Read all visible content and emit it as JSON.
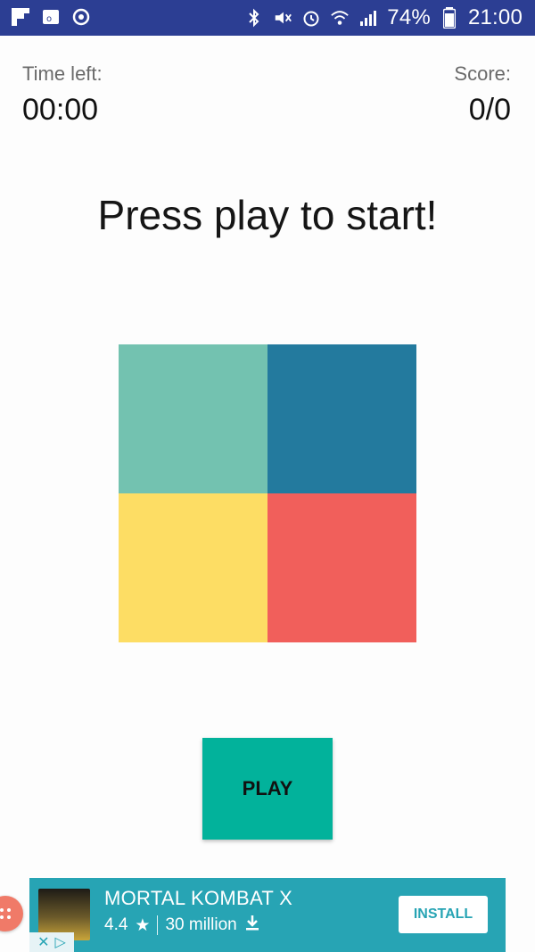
{
  "status_bar": {
    "battery": "74%",
    "time": "21:00",
    "icons": [
      "flipboard-icon",
      "outlook-icon",
      "sync-icon",
      "bluetooth-icon",
      "mute-icon",
      "alarm-icon",
      "wifi-icon",
      "signal-icon",
      "battery-icon"
    ]
  },
  "game": {
    "time_label": "Time left:",
    "time_value": "00:00",
    "score_label": "Score:",
    "score_value": "0/0",
    "prompt": "Press play to start!",
    "tiles": [
      "#73c2b0",
      "#237a9e",
      "#fddd64",
      "#f15f5b"
    ],
    "play_label": "PLAY"
  },
  "ad": {
    "title": "MORTAL KOMBAT X",
    "rating": "4.4",
    "installs": "30 million",
    "install_label": "INSTALL"
  }
}
